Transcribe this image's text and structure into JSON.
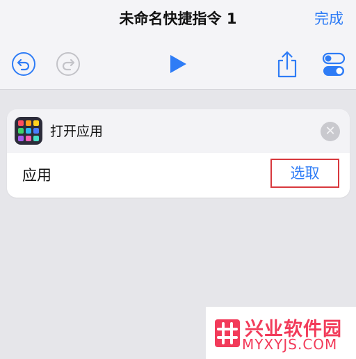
{
  "nav": {
    "title": "未命名快捷指令 1",
    "done_label": "完成"
  },
  "toolbar": {
    "undo_icon": "undo-icon",
    "redo_icon": "redo-icon",
    "run_icon": "play-icon",
    "share_icon": "share-icon",
    "settings_icon": "toggle-settings-icon",
    "redo_enabled": false
  },
  "action_card": {
    "title": "打开应用",
    "app_icon": "app-grid-icon",
    "remove_icon": "close-icon",
    "parameter_label": "应用",
    "parameter_value": "选取"
  },
  "watermark": {
    "name": "兴业软件园",
    "url": "MYXYJS.COM"
  },
  "colors": {
    "accent_blue": "#2e7cf6",
    "highlight_red": "#d8383d",
    "watermark_red": "#f23b5a",
    "background": "#e6e6ea"
  }
}
